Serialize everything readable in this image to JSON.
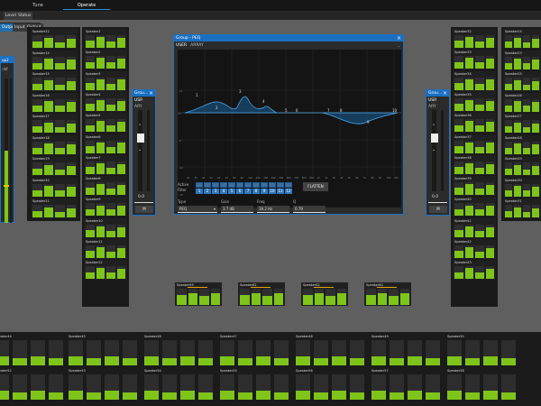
{
  "tabs": [
    {
      "label": "Tune",
      "active": false
    },
    {
      "label": "Operate",
      "active": true
    }
  ],
  "subtabs": [
    {
      "label": "Level",
      "sel": false
    },
    {
      "label": "Status",
      "sel": false
    }
  ],
  "subtabs2": [
    {
      "label": "Output",
      "sel": true
    },
    {
      "label": "Input",
      "sel": false
    },
    {
      "label": "Output",
      "sel": false
    }
  ],
  "left_panel": {
    "title": "up2",
    "value": "-Inf"
  },
  "speaker_col1": [
    "Speaker22",
    "Speaker14",
    "Speaker15",
    "Speaker16",
    "Speaker17",
    "Speaker18",
    "Speaker19",
    "Speaker20",
    "Speaker21"
  ],
  "speaker_col2": [
    "Speaker1",
    "Speaker2",
    "Speaker3",
    "Speaker4",
    "Speaker5",
    "Speaker6",
    "Speaker7",
    "Speaker8",
    "Speaker9",
    "Speaker10",
    "Speaker11",
    "Speaker12"
  ],
  "speaker_col3": [
    "Speaker32",
    "Speaker33",
    "Speaker34",
    "Speaker35",
    "Speaker36",
    "Speaker37",
    "Speaker38",
    "Speaker39",
    "Speaker40",
    "Speaker41",
    "Speaker42",
    "Speaker43"
  ],
  "speaker_col4": [
    "Speaker24",
    "Speaker23",
    "Speaker25",
    "Speaker26",
    "Speaker27",
    "Speaker28",
    "Speaker29",
    "Speaker30",
    "Speaker31",
    "Speaker44",
    "Speaker45",
    "Speaker46"
  ],
  "group_left": {
    "title": "Grou...",
    "tabs": [
      "USR",
      "ARY"
    ],
    "value": "0.0",
    "mute": "M"
  },
  "group_right": {
    "title": "Grou...",
    "tabs": [
      "USR",
      "ARY"
    ],
    "value": "0.0",
    "mute": "M"
  },
  "peq": {
    "title": "Group - PEQ",
    "tabs": [
      "USER",
      "ARRAY"
    ],
    "filter_labels": [
      "1",
      "2",
      "3",
      "4",
      "5",
      "6",
      "7",
      "8",
      "9",
      "10"
    ],
    "active_label": "Active",
    "filter_label": "Filter",
    "filter_nums": [
      "1",
      "2",
      "3",
      "4",
      "5",
      "6",
      "7",
      "8",
      "9",
      "10",
      "11",
      "12"
    ],
    "flatten": "FLATTEN",
    "type_label": "Type",
    "type_value": "PEQ",
    "gain_label": "Gain",
    "gain_value": "3.7 dB",
    "freq_label": "Freq",
    "freq_value": "39.2 Hz",
    "q_label": "Q",
    "q_value": "0.79",
    "y_ticks": [
      "+6",
      "0",
      "-6",
      "-12",
      "-18"
    ],
    "x_ticks": [
      "20",
      "30",
      "40",
      "50",
      "60",
      "70",
      "80",
      "90",
      "100",
      "200",
      "300",
      "400",
      "500",
      "600",
      "700",
      "800",
      "900",
      "1k",
      "2k",
      "3k",
      "4k",
      "5k",
      "6k",
      "7k",
      "8k",
      "9k",
      "10k",
      "20k"
    ]
  },
  "bottom_top": [
    "Speaker44",
    "Speaker45",
    "Speaker46",
    "Speaker47",
    "Speaker48",
    "Speaker49",
    "Speaker50"
  ],
  "bottom_bot": [
    "Speaker52",
    "Speaker53",
    "Speaker54",
    "Speaker55",
    "Speaker56",
    "Speaker57",
    "Speaker58"
  ],
  "mid_speakers": [
    "Speaker59",
    "Speaker61",
    "Speaker62",
    "Speaker60"
  ],
  "colors": {
    "accent": "#1b6fc1",
    "meter": "#7ec41a"
  }
}
